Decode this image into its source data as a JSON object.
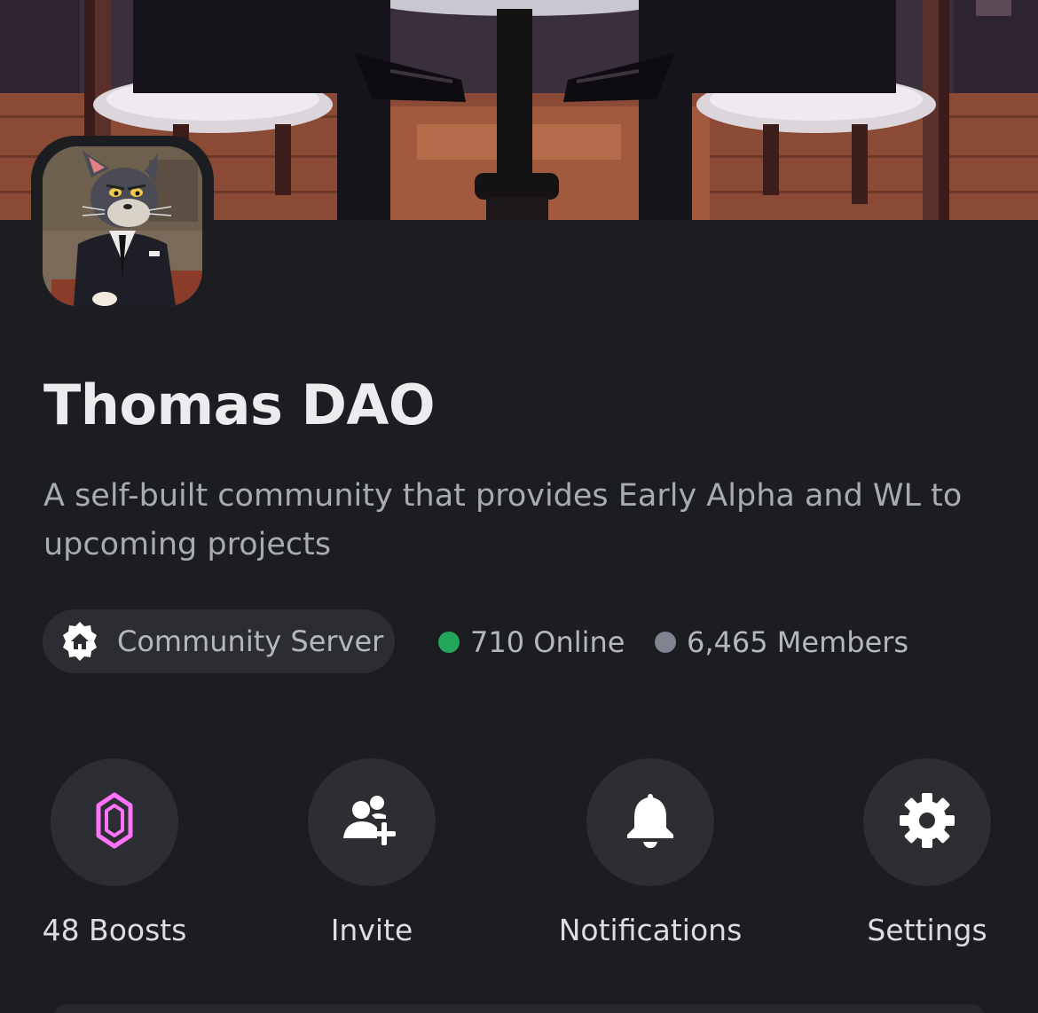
{
  "server": {
    "name": "Thomas DAO",
    "description": "A self-built community that provides Early Alpha and WL to upcoming projects"
  },
  "stats": {
    "community_label": "Community Server",
    "online_text": "710 Online",
    "members_text": "6,465 Members",
    "online_color": "#23a55a",
    "members_color": "#80848e"
  },
  "actions": [
    {
      "label": "48 Boosts",
      "icon": "boost-gem-icon",
      "color": "#ff73fa"
    },
    {
      "label": "Invite",
      "icon": "add-user-icon",
      "color": "#ffffff"
    },
    {
      "label": "Notifications",
      "icon": "bell-icon",
      "color": "#ffffff"
    },
    {
      "label": "Settings",
      "icon": "gear-icon",
      "color": "#ffffff"
    }
  ],
  "theme": {
    "background": "#1c1d21",
    "pill": "#2b2d33",
    "button": "#2c2e34"
  }
}
